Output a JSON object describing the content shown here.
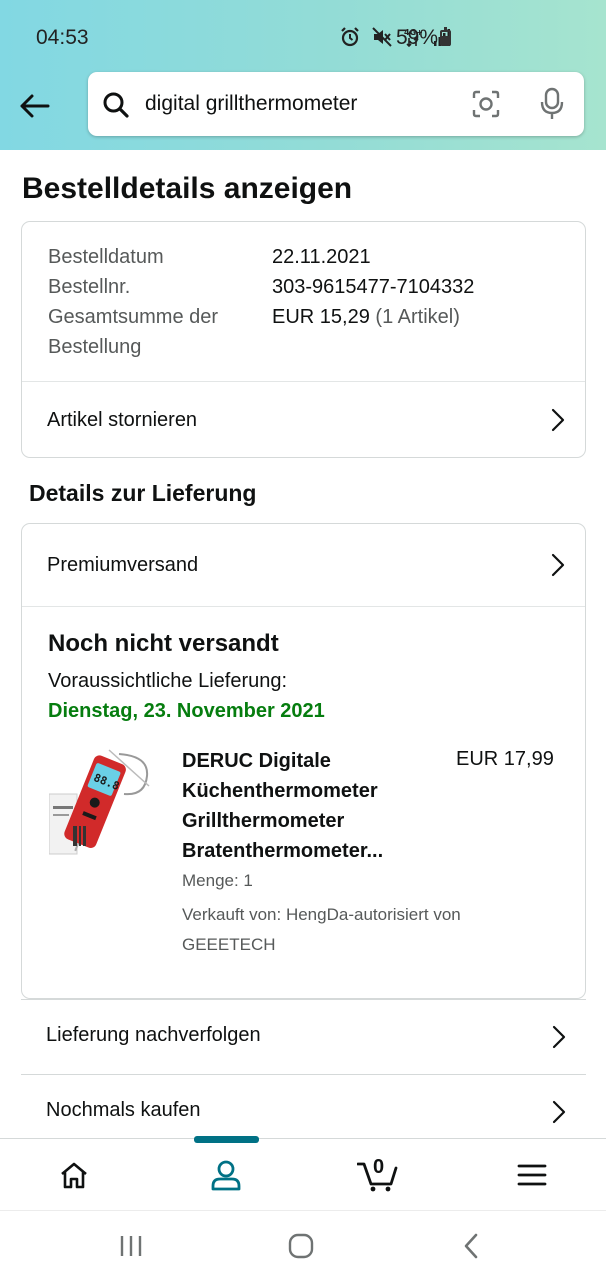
{
  "status_bar": {
    "time": "04:53",
    "battery_percent": "59%",
    "network": "4G+"
  },
  "search": {
    "value": "digital grillthermometer",
    "placeholder": ""
  },
  "page": {
    "title": "Bestelldetails anzeigen"
  },
  "order_summary": {
    "rows": [
      {
        "label": "Bestelldatum",
        "value": "22.11.2021"
      },
      {
        "label": "Bestellnr.",
        "value": "303-9615477-7104332"
      },
      {
        "label_line1": "Gesamtsumme der",
        "label_line2": "Bestellung",
        "value": "EUR 15,29",
        "value_note": "(1 Artikel)"
      }
    ],
    "cancel_label": "Artikel stornieren"
  },
  "delivery": {
    "section_title": "Details zur Lieferung",
    "shipping_method": "Premiumversand",
    "status": "Noch nicht versandt",
    "eta_label": "Voraussichtliche Lieferung:",
    "eta_date": "Dienstag, 23. November 2021",
    "eta_color": "#067d0f"
  },
  "product": {
    "title_lines": [
      "DERUC Digitale",
      "Küchenthermometer",
      "Grillthermometer",
      "Bratenthermometer..."
    ],
    "price": "EUR 17,99",
    "quantity": "Menge: 1",
    "seller_line1": "Verkauft von: HengDa-autorisiert von",
    "seller_line2": "GEEETECH"
  },
  "actions": {
    "track": "Lieferung nachverfolgen",
    "buy_again": "Nochmals kaufen"
  },
  "bottom_nav": {
    "items": [
      "home-icon",
      "account-icon",
      "cart-icon",
      "menu-icon"
    ],
    "active": "account-icon",
    "cart_count": "0",
    "accent": "#007185"
  }
}
